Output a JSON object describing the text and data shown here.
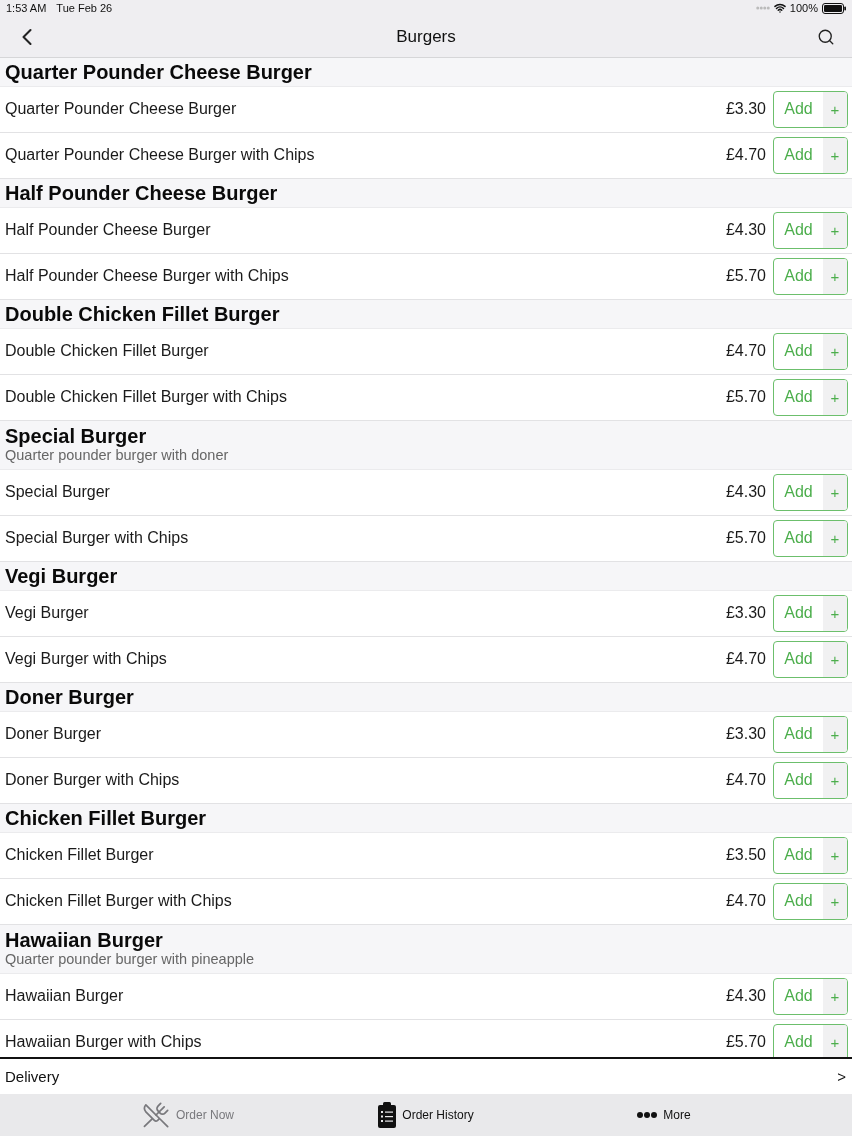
{
  "status_bar": {
    "time": "1:53 AM",
    "date": "Tue Feb 26",
    "battery": "100%"
  },
  "nav_bar": {
    "title": "Burgers"
  },
  "sections": [
    {
      "title": "Quarter Pounder Cheese Burger",
      "items": [
        {
          "name": "Quarter Pounder Cheese Burger",
          "price": "£3.30",
          "button": "Add",
          "plus": "+"
        },
        {
          "name": "Quarter Pounder Cheese Burger with Chips",
          "price": "£4.70",
          "button": "Add",
          "plus": "+"
        }
      ]
    },
    {
      "title": "Half Pounder Cheese Burger",
      "items": [
        {
          "name": "Half Pounder Cheese Burger",
          "price": "£4.30",
          "button": "Add",
          "plus": "+"
        },
        {
          "name": "Half Pounder Cheese Burger with Chips",
          "price": "£5.70",
          "button": "Add",
          "plus": "+"
        }
      ]
    },
    {
      "title": "Double Chicken Fillet Burger",
      "items": [
        {
          "name": "Double Chicken Fillet Burger",
          "price": "£4.70",
          "button": "Add",
          "plus": "+"
        },
        {
          "name": "Double Chicken Fillet Burger with Chips",
          "price": "£5.70",
          "button": "Add",
          "plus": "+"
        }
      ]
    },
    {
      "title": "Special Burger",
      "subtitle": "Quarter pounder burger with doner",
      "items": [
        {
          "name": "Special Burger",
          "price": "£4.30",
          "button": "Add",
          "plus": "+"
        },
        {
          "name": "Special Burger with Chips",
          "price": "£5.70",
          "button": "Add",
          "plus": "+"
        }
      ]
    },
    {
      "title": "Vegi Burger",
      "items": [
        {
          "name": "Vegi Burger",
          "price": "£3.30",
          "button": "Add",
          "plus": "+"
        },
        {
          "name": "Vegi Burger with Chips",
          "price": "£4.70",
          "button": "Add",
          "plus": "+"
        }
      ]
    },
    {
      "title": "Doner Burger",
      "items": [
        {
          "name": "Doner Burger",
          "price": "£3.30",
          "button": "Add",
          "plus": "+"
        },
        {
          "name": "Doner Burger with Chips",
          "price": "£4.70",
          "button": "Add",
          "plus": "+"
        }
      ]
    },
    {
      "title": "Chicken Fillet Burger",
      "items": [
        {
          "name": "Chicken Fillet Burger",
          "price": "£3.50",
          "button": "Add",
          "plus": "+"
        },
        {
          "name": "Chicken Fillet Burger with Chips",
          "price": "£4.70",
          "button": "Add",
          "plus": "+"
        }
      ]
    },
    {
      "title": "Hawaiian Burger",
      "subtitle": "Quarter pounder burger with pineapple",
      "items": [
        {
          "name": "Hawaiian Burger",
          "price": "£4.30",
          "button": "Add",
          "plus": "+"
        },
        {
          "name": "Hawaiian Burger with Chips",
          "price": "£5.70",
          "button": "Add",
          "plus": "+"
        }
      ]
    }
  ],
  "delivery_bar": {
    "label": "Delivery",
    "chevron": ">"
  },
  "tab_bar": {
    "tabs": [
      {
        "label": "Order Now",
        "selected": true
      },
      {
        "label": "Order History",
        "selected": false
      },
      {
        "label": "More",
        "selected": false
      }
    ]
  }
}
